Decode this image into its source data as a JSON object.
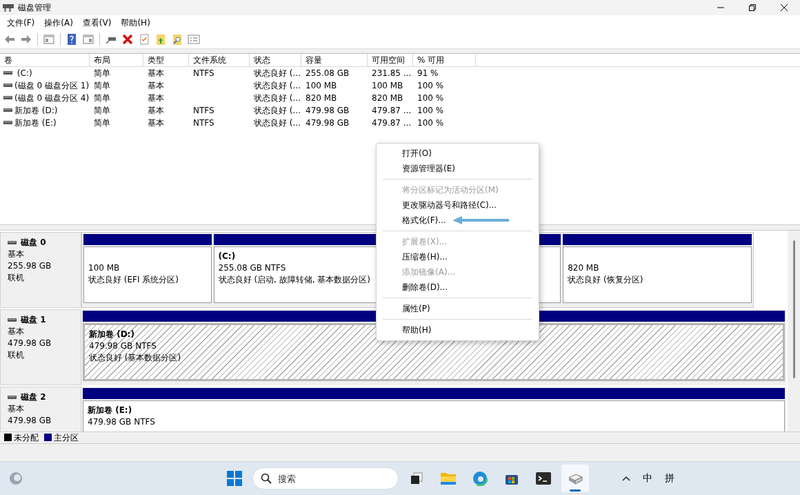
{
  "window": {
    "title": "磁盘管理"
  },
  "menu_bar": [
    "文件(F)",
    "操作(A)",
    "查看(V)",
    "帮助(H)"
  ],
  "toolbar": [
    {
      "kind": "back"
    },
    {
      "kind": "forward"
    },
    {
      "kind": "separator"
    },
    {
      "kind": "tree"
    },
    {
      "kind": "separator"
    },
    {
      "kind": "help"
    },
    {
      "kind": "panel"
    },
    {
      "kind": "separator"
    },
    {
      "kind": "connect"
    },
    {
      "kind": "delete"
    },
    {
      "kind": "check"
    },
    {
      "kind": "folder-up"
    },
    {
      "kind": "folder-search"
    },
    {
      "kind": "list"
    }
  ],
  "volume_table": {
    "columns": [
      "卷",
      "布局",
      "类型",
      "文件系统",
      "状态",
      "容量",
      "可用空间",
      "% 可用"
    ],
    "rows": [
      {
        "cells": [
          " (C:)",
          "简单",
          "基本",
          "NTFS",
          "状态良好 (...",
          "255.08 GB",
          "231.85 ...",
          "91 %"
        ]
      },
      {
        "cells": [
          "(磁盘 0 磁盘分区 1)",
          "简单",
          "基本",
          "",
          "状态良好 (...",
          "100 MB",
          "100 MB",
          "100 %"
        ]
      },
      {
        "cells": [
          "(磁盘 0 磁盘分区 4)",
          "简单",
          "基本",
          "",
          "状态良好 (...",
          "820 MB",
          "820 MB",
          "100 %"
        ]
      },
      {
        "cells": [
          "新加卷 (D:)",
          "简单",
          "基本",
          "NTFS",
          "状态良好 (...",
          "479.98 GB",
          "479.87 ...",
          "100 %"
        ]
      },
      {
        "cells": [
          "新加卷 (E:)",
          "简单",
          "基本",
          "NTFS",
          "状态良好 (...",
          "479.98 GB",
          "479.87 ...",
          "100 %"
        ]
      }
    ]
  },
  "disks": [
    {
      "name": "磁盘 0",
      "type": "基本",
      "size": "255.98 GB",
      "status": "联机",
      "partitions": [
        {
          "size": "100 MB",
          "status": "状态良好 (EFI 系统分区)",
          "selected": false
        },
        {
          "label": "(C:)",
          "size": "255.08 GB NTFS",
          "status": "状态良好 (启动, 故障转储, 基本数据分区)",
          "selected": false
        },
        {
          "size": "820 MB",
          "status": "状态良好 (恢复分区)",
          "selected": false
        }
      ]
    },
    {
      "name": "磁盘 1",
      "type": "基本",
      "size": "479.98 GB",
      "status": "联机",
      "partitions": [
        {
          "label": "新加卷  (D:)",
          "size": "479.98 GB NTFS",
          "status": "状态良好 (基本数据分区)",
          "selected": true
        }
      ]
    },
    {
      "name": "磁盘 2",
      "type": "基本",
      "size": "479.98 GB",
      "partitions": [
        {
          "label": "新加卷  (E:)",
          "size": "479.98 GB NTFS",
          "selected": false
        }
      ]
    }
  ],
  "legend": [
    {
      "label": "未分配",
      "color": "#000000"
    },
    {
      "label": "主分区",
      "color": "#000080"
    }
  ],
  "context_menu": {
    "items": [
      {
        "kind": "item",
        "label": "打开(O)",
        "disabled": false
      },
      {
        "kind": "item",
        "label": "资源管理器(E)",
        "disabled": false
      },
      {
        "kind": "separator"
      },
      {
        "kind": "item",
        "label": "将分区标记为活动分区(M)",
        "disabled": true
      },
      {
        "kind": "item",
        "label": "更改驱动器号和路径(C)...",
        "disabled": false
      },
      {
        "kind": "item",
        "label": "格式化(F)...",
        "disabled": false,
        "pointed": true
      },
      {
        "kind": "separator"
      },
      {
        "kind": "item",
        "label": "扩展卷(X)...",
        "disabled": true
      },
      {
        "kind": "item",
        "label": "压缩卷(H)...",
        "disabled": false
      },
      {
        "kind": "item",
        "label": "添加镜像(A)...",
        "disabled": true
      },
      {
        "kind": "item",
        "label": "删除卷(D)...",
        "disabled": false
      },
      {
        "kind": "separator"
      },
      {
        "kind": "item",
        "label": "属性(P)",
        "disabled": false
      },
      {
        "kind": "separator"
      },
      {
        "kind": "item",
        "label": "帮助(H)",
        "disabled": false
      }
    ]
  },
  "taskbar": {
    "search": {
      "placeholder": "搜索"
    },
    "apps": [
      {
        "kind": "task-view",
        "selected": false
      },
      {
        "kind": "explorer",
        "selected": false
      },
      {
        "kind": "edge",
        "selected": false
      },
      {
        "kind": "store",
        "selected": false
      },
      {
        "kind": "terminal",
        "selected": false
      },
      {
        "kind": "disk",
        "selected": true
      }
    ],
    "tray": [
      "中",
      "拼"
    ]
  }
}
